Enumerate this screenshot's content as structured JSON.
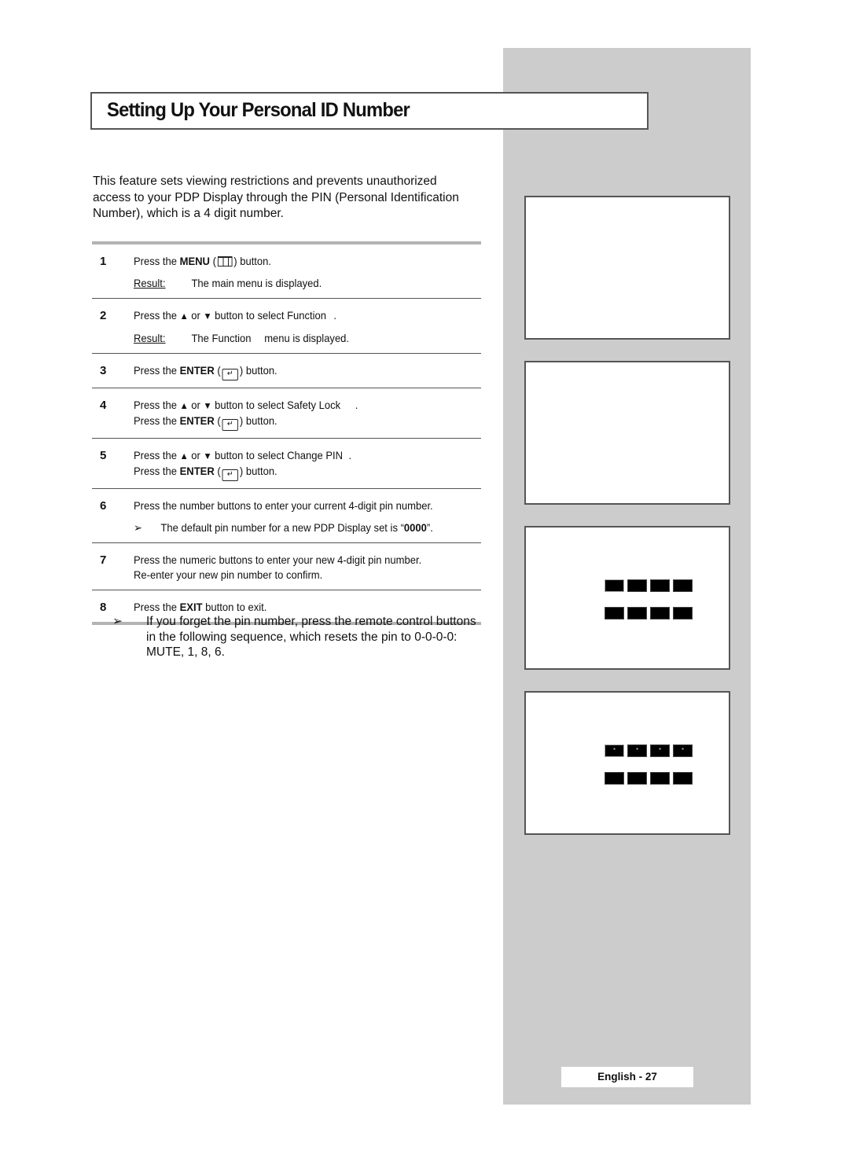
{
  "title": "Setting Up Your Personal ID Number",
  "intro": "This feature sets viewing restrictions and prevents unauthorized access to your PDP Display through the PIN (Personal Identification Number), which is a 4 digit number.",
  "result_label": "Result:",
  "steps": [
    {
      "num": "1",
      "pre": "Press the ",
      "bold": "MENU",
      "post": " button.",
      "icon": "menu-icon",
      "result": "The main menu is displayed."
    },
    {
      "num": "2",
      "pre": "Press the ",
      "up": "▲",
      "or": " or ",
      "down": "▼",
      "post": " button to select Function",
      "end": ".",
      "result_pre": "The Function",
      "result_post": "menu is displayed."
    },
    {
      "num": "3",
      "pre": "Press the ",
      "bold": "ENTER",
      "post": " button."
    },
    {
      "num": "4",
      "pre": "Press the ",
      "up": "▲",
      "or": " or ",
      "down": "▼",
      "post": " button to select Safety Lock",
      "end": ".",
      "line2_pre": "Press the ",
      "line2_bold": "ENTER",
      "line2_post": " button."
    },
    {
      "num": "5",
      "pre": "Press the ",
      "up": "▲",
      "or": " or ",
      "down": "▼",
      "post": " button to select Change PIN",
      "end": ".",
      "line2_pre": "Press the ",
      "line2_bold": "ENTER",
      "line2_post": " button."
    },
    {
      "num": "6",
      "text": "Press the number buttons to enter your current 4-digit pin number.",
      "note_pre": "The default pin number for a new PDP Display set is “",
      "note_bold": "0000",
      "note_post": "”."
    },
    {
      "num": "7",
      "text": "Press the numeric buttons to enter your new 4-digit pin number.",
      "line2": "Re-enter your new pin number to confirm."
    },
    {
      "num": "8",
      "pre": "Press the ",
      "bold": "EXIT",
      "post": " button to exit."
    }
  ],
  "tip": "If you forget the pin number, press the remote control buttons in the following sequence, which resets the pin to 0-0-0-0: MUTE, 1, 8, 6.",
  "arrow_glyph": "➢",
  "enter_glyph": "↵",
  "pin_mask": "*",
  "page_label": "English - 27"
}
